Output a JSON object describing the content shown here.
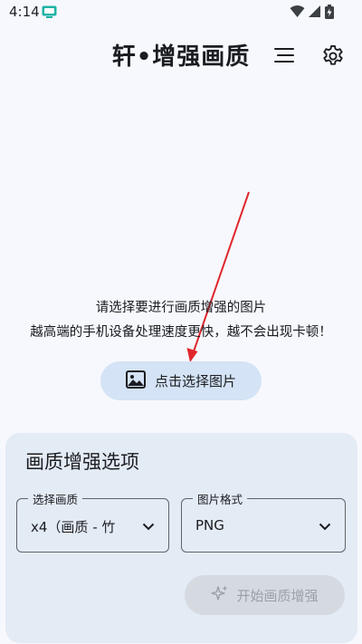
{
  "status_bar": {
    "time": "4:14",
    "icons": [
      "app-notification-icon",
      "wifi-icon",
      "signal-icon",
      "battery-icon"
    ]
  },
  "header": {
    "title": "轩•增强画质",
    "menu_icon": "menu-icon",
    "settings_icon": "gear-icon"
  },
  "hint": {
    "line1": "请选择要进行画质增强的图片",
    "line2": "越高端的手机设备处理速度更快，越不会出现卡顿！"
  },
  "pick_button": {
    "label": "点击选择图片",
    "icon": "image-icon"
  },
  "options": {
    "title": "画质增强选项",
    "quality": {
      "label": "选择画质",
      "value": "x4（画质 - 竹"
    },
    "format": {
      "label": "图片格式",
      "value": "PNG"
    },
    "start_button": {
      "label": "开始画质增强",
      "icon": "sparkle-icon",
      "enabled": false
    }
  },
  "colors": {
    "background": "#f7f8fd",
    "card": "#e3ebf5",
    "pick_button": "#d4e3f5",
    "disabled_button": "#d5dae1",
    "arrow": "#e0262b"
  }
}
